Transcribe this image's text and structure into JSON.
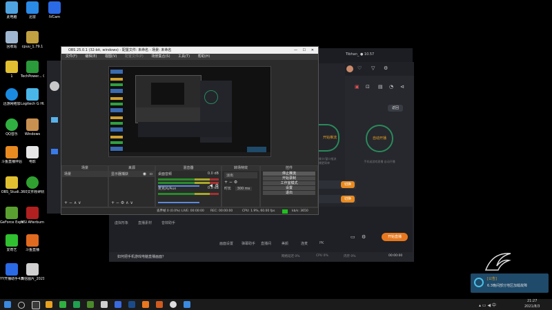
{
  "desktop": {
    "icons": [
      {
        "label": "此电脑",
        "color": "#4fa3e0"
      },
      {
        "label": "迅雷",
        "color": "#2a8ae6"
      },
      {
        "label": "iVCam",
        "color": "#2a6ae6"
      },
      {
        "label": "回收站",
        "color": "#9fb7d0"
      },
      {
        "label": "cpuu_1.79.1",
        "color": "#c0a040"
      },
      {
        "label": "1",
        "color": "#e0c030"
      },
      {
        "label": "TechPower... GPU-Z",
        "color": "#2a9a3a"
      },
      {
        "label": "迅游网络加",
        "color": "#1a8ae0"
      },
      {
        "label": "Logitech G HUB",
        "color": "#4ab6e8"
      },
      {
        "label": "QQ音乐",
        "color": "#30b040"
      },
      {
        "label": "Windows",
        "color": "#c89050"
      },
      {
        "label": "斗鱼直播伴侣",
        "color": "#e88a20"
      },
      {
        "label": "电影",
        "color": "#e6e6e6"
      },
      {
        "label": "OBS_Studi...",
        "color": "#e0c030"
      },
      {
        "label": "360文件粉碎机 6",
        "color": "#30a030"
      },
      {
        "label": "GeForce Experience",
        "color": "#5aa030"
      },
      {
        "label": "MSI Afterburner",
        "color": "#b02020"
      },
      {
        "label": "爱奇艺",
        "color": "#30c030"
      },
      {
        "label": "斗鱼直播",
        "color": "#e06a20"
      },
      {
        "label": "YY开播助手4.5",
        "color": "#2a6ae6"
      },
      {
        "label": "微信图片_2021080...",
        "color": "#d0d0d0"
      }
    ]
  },
  "obs": {
    "title": "OBS 25.0.1 (32-bit, windows) - 配置文件: 未命名 - 场景: 未命名",
    "menu": [
      "文件(F)",
      "编辑(E)",
      "视图(V)",
      "配置文件(P)",
      "场景集合(S)",
      "工具(T)",
      "帮助(H)"
    ],
    "docks": {
      "scenes": {
        "title": "场景",
        "items": [
          "场景"
        ]
      },
      "sources": {
        "title": "来源",
        "items": [
          "显示器捕获"
        ]
      },
      "mixer": {
        "title": "混音器",
        "tracks": [
          {
            "name": "桌面音频",
            "db": "0.0 dB"
          },
          {
            "name": "麦克风/Aux",
            "db": "0.0 dB"
          }
        ]
      },
      "transitions": {
        "title": "转场特效",
        "fade": "淡出",
        "duration_label": "时长",
        "duration": "300 ms"
      },
      "controls": {
        "title": "控件",
        "buttons": [
          "停止推流",
          "开始录制",
          "工作室模式",
          "设置",
          "退出"
        ]
      }
    },
    "status": {
      "dropped": "丢弃帧 0 (0.0%)",
      "live": "LIVE: 00:00:00",
      "rec": "REC: 00:00:00",
      "cpu": "CPU: 1.9%, 60.00 fps",
      "bitrate": "kb/s: 3650"
    }
  },
  "bg_app": {
    "title": "Tibhan_ ● 10.57",
    "back_button": "返回",
    "mode_left": "开始推流",
    "mode_right": "自动开播",
    "desc_left": "摄像头/窗口推流 开播更简单",
    "desc_right": "手机或游戏直播 自动开播",
    "toggle1": "切换",
    "toggle2": "切换",
    "hint": "画面出现重复效果",
    "bottom_items": [
      "画面设置",
      "弹幕助手",
      "直播间",
      "美颜",
      "连麦",
      "PK",
      "更多"
    ],
    "bottom_left": [
      "虚拟形象",
      "直播素材",
      "音效助手"
    ],
    "start_button": "开始直播",
    "notice_text": "如何把手机游戏电脑直播画面？",
    "stats": [
      " ",
      " ",
      "网络延迟 0%",
      "CPU 0%",
      "内存 0%",
      "00:00:00"
    ]
  },
  "notification": {
    "title": "[公告]",
    "body": "6.3晚间部分地区加载故障"
  },
  "taskbar": {
    "time": "21:27",
    "date": "2021/8/3"
  }
}
